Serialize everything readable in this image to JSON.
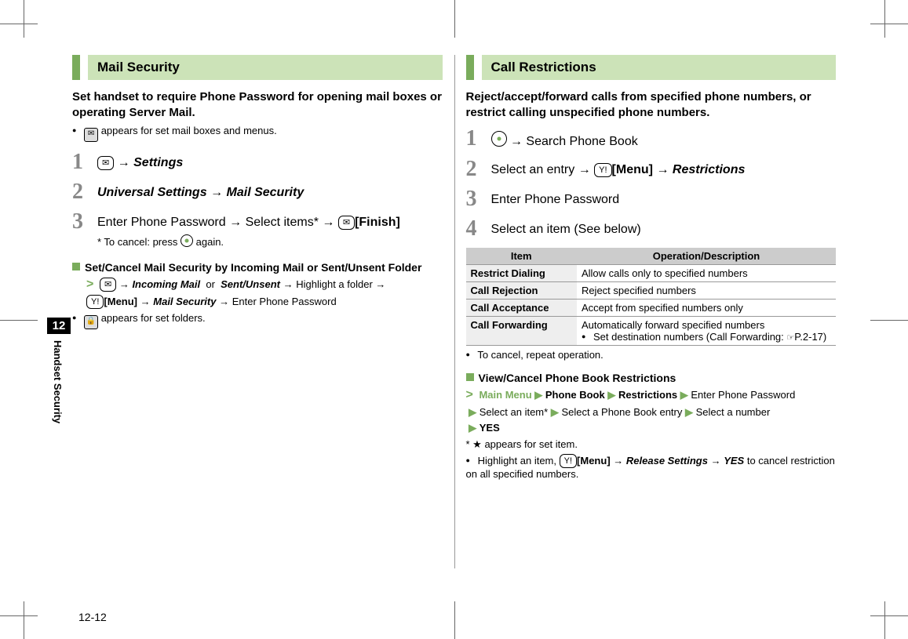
{
  "side": {
    "chapter_num": "12",
    "chapter_name": "Handset Security"
  },
  "page_number": "12-12",
  "left": {
    "header": "Mail Security",
    "intro": "Set handset to require Phone Password for opening mail boxes or operating Server Mail.",
    "note1": "appears for set mail boxes and menus.",
    "step1_label": "Settings",
    "step2_a": "Universal Settings",
    "step2_b": "Mail Security",
    "step3_a": "Enter Phone Password",
    "step3_b": "Select items*",
    "step3_finish": "[Finish]",
    "step3_note": "* To cancel: press",
    "step3_note_end": "again.",
    "sub_h": "Set/Cancel Mail Security by Incoming Mail or Sent/Unsent Folder",
    "sub_incoming": "Incoming Mail",
    "sub_or": "or",
    "sub_sentunsent": "Sent/Unsent",
    "sub_hl": "Highlight a folder",
    "sub_menu": "[Menu]",
    "sub_ms": "Mail Security",
    "sub_enter": "Enter Phone Password",
    "note2": "appears for set folders."
  },
  "right": {
    "header": "Call Restrictions",
    "intro": "Reject/accept/forward calls from specified phone numbers, or restrict calling unspecified phone numbers.",
    "step1": "Search Phone Book",
    "step2_a": "Select an entry",
    "step2_menu": "[Menu]",
    "step2_b": "Restrictions",
    "step3": "Enter Phone Password",
    "step4": "Select an item (See below)",
    "table": {
      "h1": "Item",
      "h2": "Operation/Description",
      "rows": [
        {
          "k": "Restrict Dialing",
          "v": "Allow calls only to specified numbers"
        },
        {
          "k": "Call Rejection",
          "v": "Reject specified numbers"
        },
        {
          "k": "Call Acceptance",
          "v": "Accept from specified numbers only"
        },
        {
          "k": "Call Forwarding",
          "v": "Automatically forward specified numbers",
          "v2": "Set destination numbers (Call Forwarding:",
          "v2ref": "P.2-17)"
        }
      ]
    },
    "after_table": "To cancel, repeat operation.",
    "sub2_h": "View/Cancel Phone Book Restrictions",
    "mm": "Main Menu",
    "pb": "Phone Book",
    "restr": "Restrictions",
    "epp": "Enter Phone Password",
    "sel_item": "Select an item*",
    "sel_entry": "Select a Phone Book entry",
    "sel_num": "Select a number",
    "yes": "YES",
    "star_note": "appears for set item.",
    "cancel_a": "Highlight an item,",
    "cancel_menu": "[Menu]",
    "cancel_b": "Release Settings",
    "cancel_yes": "YES",
    "cancel_c": "to cancel restriction on all specified numbers."
  }
}
